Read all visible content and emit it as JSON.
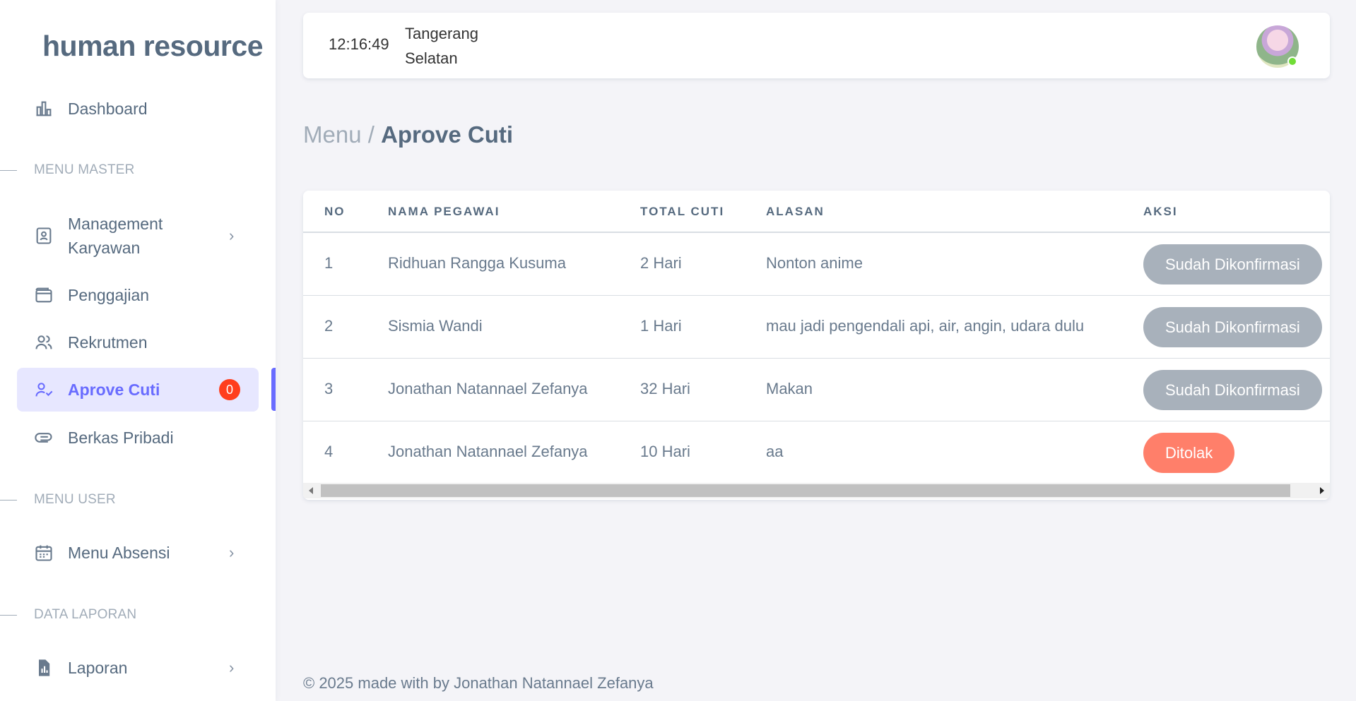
{
  "brand": "human resource",
  "sidebar": {
    "items": [
      {
        "label": "Dashboard",
        "icon": "bar-chart-icon"
      },
      {
        "label": "Management Karyawan",
        "icon": "id-card-icon"
      },
      {
        "label": "Penggajian",
        "icon": "wallet-icon"
      },
      {
        "label": "Rekrutmen",
        "icon": "users-icon"
      },
      {
        "label": "Aprove Cuti",
        "icon": "user-check-icon",
        "badge": "0",
        "active": true
      },
      {
        "label": "Berkas Pribadi",
        "icon": "paperclip-icon"
      },
      {
        "label": "Menu Absensi",
        "icon": "calendar-icon"
      },
      {
        "label": "Laporan",
        "icon": "report-file-icon"
      }
    ],
    "sections": [
      "MENU MASTER",
      "MENU USER",
      "DATA LAPORAN"
    ]
  },
  "navbar": {
    "time": "12:16:49",
    "location": "Tangerang Selatan"
  },
  "breadcrumb": {
    "parent": "Menu /",
    "current": "Aprove Cuti"
  },
  "table": {
    "headers": [
      "NO",
      "NAMA PEGAWAI",
      "TOTAL CUTI",
      "ALASAN",
      "AKSI"
    ],
    "rows": [
      {
        "no": "1",
        "nama": "Ridhuan Rangga Kusuma",
        "total": "2 Hari",
        "alasan": "Nonton anime",
        "aksi": "Sudah Dikonfirmasi"
      },
      {
        "no": "2",
        "nama": "Sismia Wandi",
        "total": "1 Hari",
        "alasan": "mau jadi pengendali api, air, angin, udara dulu",
        "aksi": "Sudah Dikonfirmasi"
      },
      {
        "no": "3",
        "nama": "Jonathan Natannael Zefanya",
        "total": "32 Hari",
        "alasan": "Makan",
        "aksi": "Sudah Dikonfirmasi"
      },
      {
        "no": "4",
        "nama": "Jonathan Natannael Zefanya",
        "total": "10 Hari",
        "alasan": "aa",
        "aksi": "Ditolak"
      }
    ]
  },
  "colors": {
    "primary": "#696cff",
    "confirmed_button": "#a8b1bb",
    "rejected_button": "#ff7f6a",
    "badge": "#ff3e1d"
  },
  "footer": "© 2025 made with by Jonathan Natannael Zefanya"
}
